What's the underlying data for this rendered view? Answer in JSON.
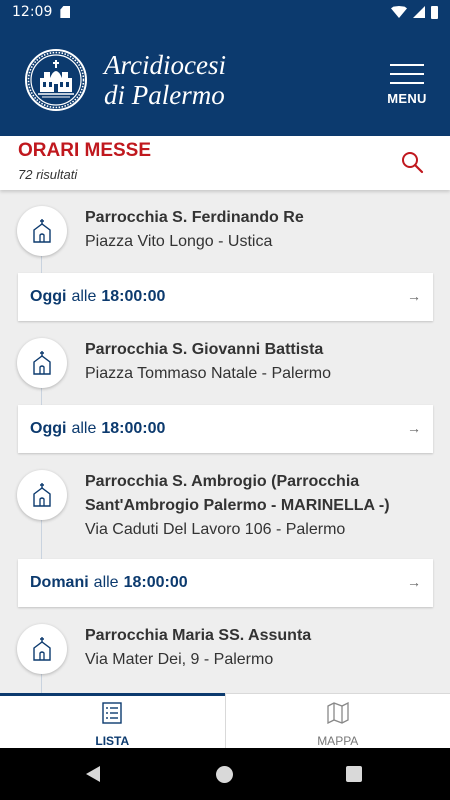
{
  "status_bar": {
    "time": "12:09"
  },
  "header": {
    "brand_line1": "Arcidiocesi",
    "brand_line2": "di Palermo",
    "menu_label": "MENU"
  },
  "page": {
    "title": "ORARI MESSE",
    "results": "72 risultati"
  },
  "entries": [
    {
      "name": "Parrocchia S. Ferdinando Re",
      "name2": "",
      "address": "Piazza Vito Longo - Ustica",
      "day": "Oggi",
      "alle": "alle",
      "time": "18:00:00"
    },
    {
      "name": "Parrocchia S. Giovanni Battista",
      "name2": "",
      "address": "Piazza Tommaso Natale - Palermo",
      "day": "Oggi",
      "alle": "alle",
      "time": "18:00:00"
    },
    {
      "name": "Parrocchia S. Ambrogio (Parrocchia",
      "name2": "Sant'Ambrogio Palermo - MARINELLA -)",
      "address": "Via Caduti Del Lavoro 106 - Palermo",
      "day": "Domani",
      "alle": "alle",
      "time": "18:00:00"
    },
    {
      "name": "Parrocchia Maria SS. Assunta",
      "name2": "",
      "address": "Via Mater Dei, 9 - Palermo",
      "day": "",
      "alle": "",
      "time": ""
    }
  ],
  "tabs": [
    {
      "label": "LISTA",
      "active": true,
      "icon": "list-icon"
    },
    {
      "label": "MAPPA",
      "active": false,
      "icon": "map-icon"
    }
  ],
  "colors": {
    "primary": "#0c3a6e",
    "accent": "#c0181e",
    "background": "#eeeeee"
  }
}
